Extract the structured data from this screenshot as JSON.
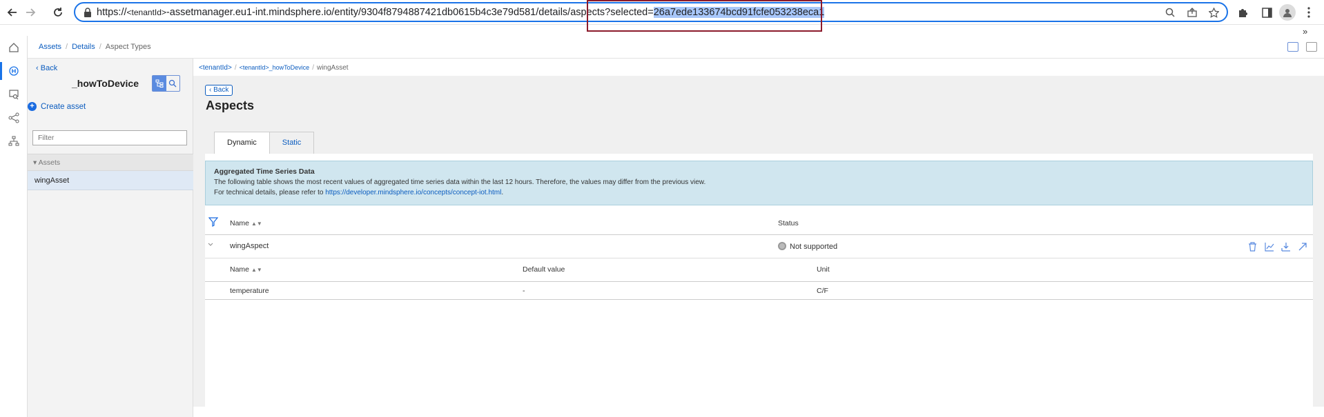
{
  "browser": {
    "url_prefix": "https://",
    "url_tenant": "<tenantId>",
    "url_middle": "-assetmanager.eu1-int.mindsphere.io/entity/9304f8794887421db0615b4c3e79d581/details/aspects?selected=",
    "url_selected": "26a7ede133674bcd91fcfe053238eca1",
    "overflow_chevron": "»"
  },
  "topbar": {
    "crumbs": [
      "Assets",
      "Details",
      "Aspect Types"
    ]
  },
  "panel": {
    "back_label": "Back",
    "title": "_howToDevice",
    "create_label": "Create asset",
    "filter_placeholder": "Filter",
    "assets_header": "Assets",
    "assets": [
      "wingAsset"
    ]
  },
  "main": {
    "crumbs": [
      "<tenantId>",
      "<tenantId>_howToDevice",
      "wingAsset"
    ],
    "back_label": "Back",
    "title": "Aspects",
    "tabs": [
      "Dynamic",
      "Static"
    ],
    "info": {
      "title": "Aggregated Time Series Data",
      "line1": "The following table shows the most recent values of aggregated time series data within the last 12 hours. Therefore, the values may differ from the previous view.",
      "line2_prefix": "For technical details, please refer to ",
      "line2_link": "https://developer.mindsphere.io/concepts/concept-iot.html",
      "line2_suffix": "."
    },
    "table": {
      "col_name": "Name",
      "col_status": "Status",
      "rows": [
        {
          "name": "wingAspect",
          "status": "Not supported"
        }
      ]
    },
    "subtable": {
      "col_name": "Name",
      "col_default": "Default value",
      "col_unit": "Unit",
      "rows": [
        {
          "name": "temperature",
          "default": "-",
          "unit": "C/F"
        }
      ]
    }
  }
}
